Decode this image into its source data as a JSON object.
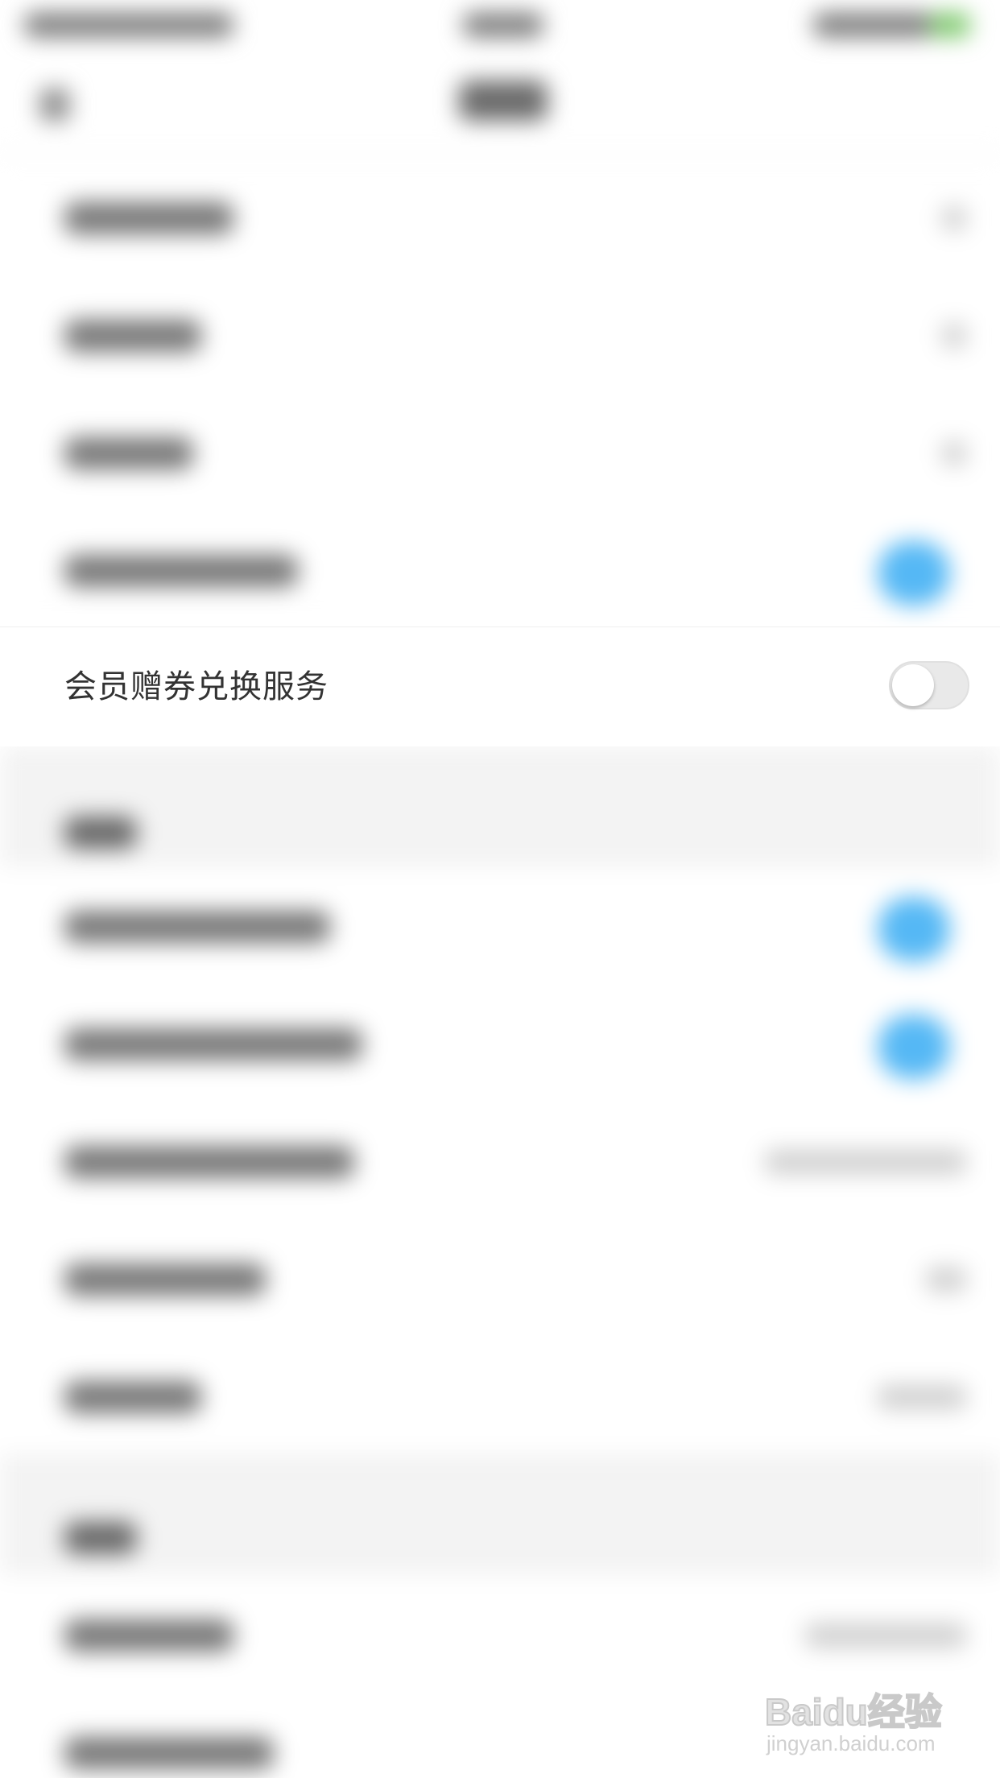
{
  "settings": {
    "coupon_exchange_label": "会员赠券兑换服务",
    "coupon_exchange_enabled": false
  },
  "watermark": {
    "main": "Baidu经验",
    "sub": "jingyan.baidu.com"
  },
  "colors": {
    "toggle_off_track": "#e9e9e9",
    "toggle_on_blurred": "#55b8f5",
    "label_text": "#333333"
  }
}
